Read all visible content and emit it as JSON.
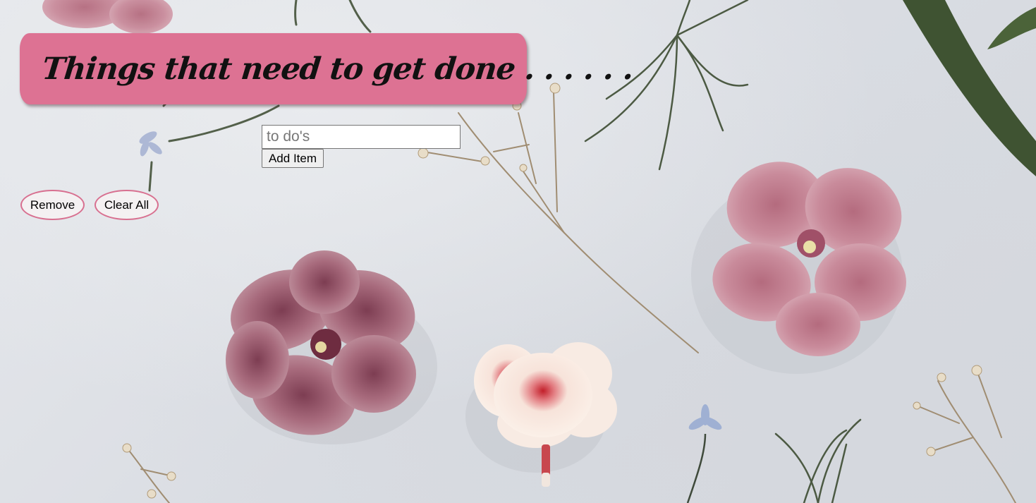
{
  "header": {
    "title": "Things that need to get done . . . . . ."
  },
  "form": {
    "input_placeholder": "to do's",
    "input_value": "",
    "add_label": "Add Item"
  },
  "actions": {
    "remove_label": "Remove",
    "clear_label": "Clear All"
  },
  "theme": {
    "banner_color": "#dd7293",
    "button_border_color": "#d87090",
    "background_color": "#dfe2e7"
  }
}
